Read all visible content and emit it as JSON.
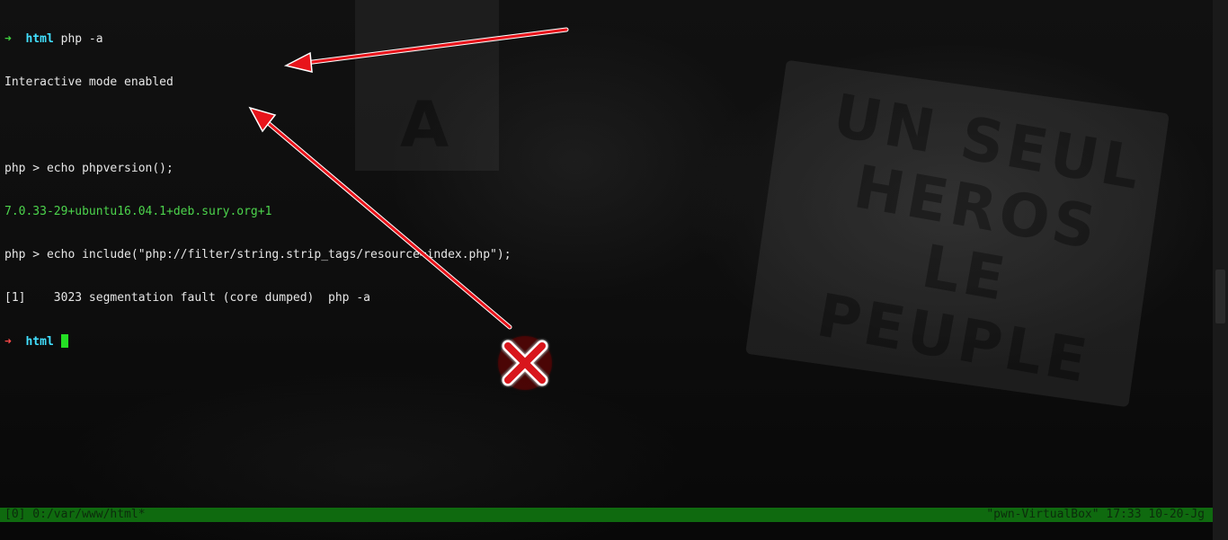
{
  "terminal": {
    "lines": [
      {
        "arrow": "➜",
        "dir": "html",
        "cmd": " php -a"
      },
      {
        "text": "Interactive mode enabled"
      },
      {
        "text": ""
      },
      {
        "text": "php > echo phpversion();"
      },
      {
        "text": "7.0.33-29+ubuntu16.04.1+deb.sury.org+1"
      },
      {
        "text": "php > echo include(\"php://filter/string.strip_tags/resource=index.php\");"
      },
      {
        "text": "[1]    3023 segmentation fault (core dumped)  php -a"
      },
      {
        "arrow": "➜",
        "dir": "html"
      }
    ]
  },
  "status_bar": {
    "left": "[0] 0:/var/www/html*",
    "right": "\"pwn-VirtualBox\" 17:33 10-20-Jg"
  },
  "background": {
    "banner_text": "UN SEUL HEROS LE PEUPLE",
    "sign_letter": "A"
  },
  "colors": {
    "prompt_green": "#3fd13f",
    "prompt_red": "#ff4a4a",
    "dir_cyan": "#42e0ff",
    "version_green": "#4cd44c",
    "status_bg": "#0f6a0f",
    "annotation_red": "#e8141b"
  },
  "icons": {
    "error_mark": "red-x-icon"
  }
}
